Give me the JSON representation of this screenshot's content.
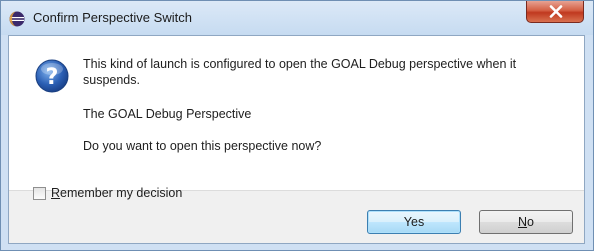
{
  "window": {
    "title": "Confirm Perspective Switch",
    "title_icon": "eclipse-icon",
    "close_icon": "close-icon"
  },
  "message": {
    "icon": "question-icon",
    "main": "This kind of launch is configured to open the GOAL Debug perspective when it suspends.",
    "perspective": "The GOAL Debug Perspective",
    "question": "Do you want to open this perspective now?"
  },
  "remember": {
    "label_prefix": "R",
    "label_rest": "emember my decision",
    "checked": false
  },
  "buttons": {
    "yes": "Yes",
    "no_mnemonic": "N",
    "no_rest": "o"
  },
  "colors": {
    "titlebar": "#c6dbf1",
    "close_button": "#c0391f",
    "default_button_border": "#3c7fb1",
    "question_icon": "#2b5fb4"
  }
}
